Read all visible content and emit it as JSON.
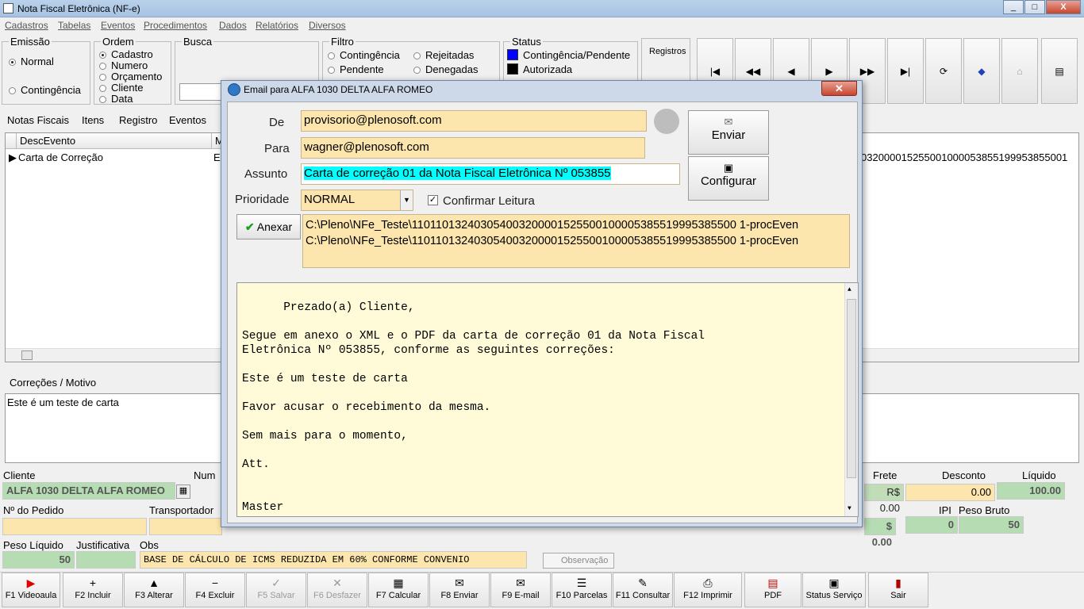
{
  "window": {
    "title": "Nota Fiscal Eletrônica (NF-e)",
    "min": "_",
    "max": "□",
    "close": "X"
  },
  "menu": [
    "Cadastros",
    "Tabelas",
    "Eventos",
    "Procedimentos",
    "Dados",
    "Relatórios",
    "Diversos"
  ],
  "emissao": {
    "label": "Emissão",
    "options": [
      "Normal",
      "Contingência"
    ],
    "selected": "Normal"
  },
  "ordem": {
    "label": "Ordem",
    "options": [
      "Cadastro",
      "Numero",
      "Orçamento",
      "Cliente",
      "Data"
    ],
    "selected": "Cadastro"
  },
  "busca": {
    "label": "Busca"
  },
  "filtro": {
    "label": "Filtro",
    "options": [
      "Contingência",
      "Rejeitadas",
      "Pendente",
      "Denegadas"
    ]
  },
  "status": {
    "label": "Status",
    "items": [
      {
        "label": "Contingência/Pendente",
        "color": "#0000ff"
      },
      {
        "label": "Autorizada",
        "color": "#000000"
      }
    ]
  },
  "registros": {
    "label": "Registros"
  },
  "tabs": [
    "Notas Fiscais",
    "Itens",
    "Registro",
    "Eventos"
  ],
  "grid": {
    "columns": [
      "DescEvento",
      "M"
    ],
    "row": {
      "desc": "Carta de Correção",
      "m": "E",
      "key": "032000015255001000053855199953855001"
    }
  },
  "correcoes": {
    "label": "Correções / Motivo",
    "text": "Este é um teste de carta"
  },
  "bottom": {
    "cliente_label": "Cliente",
    "cliente_value": "ALFA 1030 DELTA ALFA ROMEO",
    "numero_label": "Num",
    "frete_label": "Frete",
    "frete_value": "R$ 0.00",
    "desconto_label": "Desconto",
    "desconto_value": "0.00",
    "liquido_label": "Líquido",
    "liquido_value": "100.00",
    "pedido_label": "Nº do Pedido",
    "transportador_label": "Transportador",
    "ipi_label": "IPI",
    "ipi_value": "0",
    "pb_label": "Peso Bruto",
    "pb_value": "50",
    "r_value": "$ 0.00",
    "pl_label": "Peso Líquido",
    "pl_value": "50",
    "just_label": "Justificativa",
    "obs_label": "Obs",
    "obs_value": "BASE DE CÁLCULO DE ICMS REDUZIDA EM  60%  CONFORME  CONVENIO",
    "obs_button": "Observação"
  },
  "fkeys": [
    {
      "label": "F1 Videoaula",
      "icon": "▶",
      "color": "#e00000"
    },
    {
      "label": "F2 Incluir",
      "icon": "+"
    },
    {
      "label": "F3 Alterar",
      "icon": "▲"
    },
    {
      "label": "F4 Excluir",
      "icon": "−"
    },
    {
      "label": "F5 Salvar",
      "icon": "✓"
    },
    {
      "label": "F6 Desfazer",
      "icon": "✕"
    },
    {
      "label": "F7 Calcular",
      "icon": "▦"
    },
    {
      "label": "F8 Enviar",
      "icon": "✉"
    },
    {
      "label": "F9 E-mail",
      "icon": "✉"
    },
    {
      "label": "F10 Parcelas",
      "icon": "☰"
    },
    {
      "label": "F11 Consultar",
      "icon": "✎"
    },
    {
      "label": "F12 Imprimir",
      "icon": "⎙"
    },
    {
      "label": "PDF",
      "icon": "▤",
      "color": "#d00000"
    },
    {
      "label": "Status Serviço",
      "icon": "▣"
    },
    {
      "label": "Sair",
      "icon": "▮",
      "color": "#b00000"
    }
  ],
  "dialog": {
    "title": "Email para ALFA 1030 DELTA ALFA ROMEO",
    "de_label": "De",
    "de_value": "provisorio@plenosoft.com",
    "para_label": "Para",
    "para_value": "wagner@plenosoft.com",
    "assunto_label": "Assunto",
    "assunto_value": "Carta de correção 01 da Nota Fiscal Eletrônica Nº 053855",
    "prioridade_label": "Prioridade",
    "prioridade_value": "NORMAL",
    "confirmar_label": "Confirmar Leitura",
    "enviar_label": "Enviar",
    "configurar_label": "Configurar",
    "anexar_label": "Anexar",
    "attachments": [
      "C:\\Pleno\\NFe_Teste\\110110132403054003200001525500100005385519995385500 1-procEven",
      "C:\\Pleno\\NFe_Teste\\110110132403054003200001525500100005385519995385500 1-procEven"
    ],
    "body": "Prezado(a) Cliente,\n\nSegue em anexo o XML e o PDF da carta de correção 01 da Nota Fiscal\nEletrônica Nº 053855, conforme as seguintes correções:\n\nEste é um teste de carta\n\nFavor acusar o recebimento da mesma.\n\nSem mais para o momento,\n\nAtt.\n\n\nMaster\nSEU NOME DE FANTASIA"
  }
}
